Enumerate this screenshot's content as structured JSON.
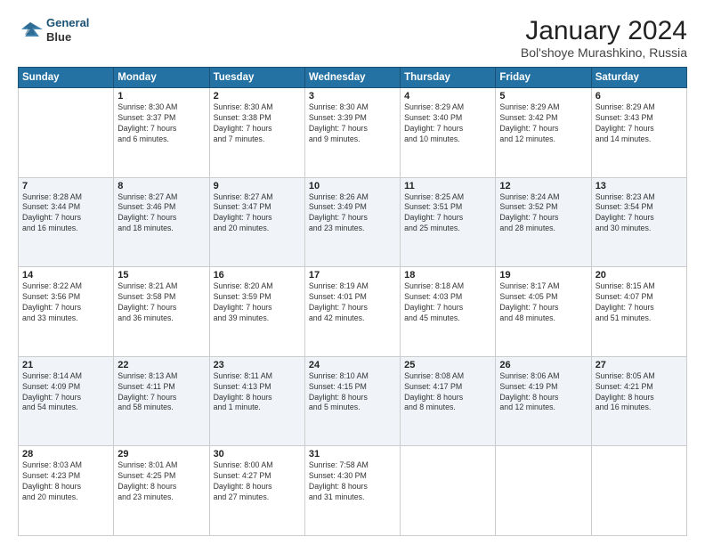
{
  "header": {
    "logo_line1": "General",
    "logo_line2": "Blue",
    "title": "January 2024",
    "subtitle": "Bol'shoye Murashkino, Russia"
  },
  "calendar": {
    "headers": [
      "Sunday",
      "Monday",
      "Tuesday",
      "Wednesday",
      "Thursday",
      "Friday",
      "Saturday"
    ],
    "rows": [
      [
        {
          "day": "",
          "content": ""
        },
        {
          "day": "1",
          "content": "Sunrise: 8:30 AM\nSunset: 3:37 PM\nDaylight: 7 hours\nand 6 minutes."
        },
        {
          "day": "2",
          "content": "Sunrise: 8:30 AM\nSunset: 3:38 PM\nDaylight: 7 hours\nand 7 minutes."
        },
        {
          "day": "3",
          "content": "Sunrise: 8:30 AM\nSunset: 3:39 PM\nDaylight: 7 hours\nand 9 minutes."
        },
        {
          "day": "4",
          "content": "Sunrise: 8:29 AM\nSunset: 3:40 PM\nDaylight: 7 hours\nand 10 minutes."
        },
        {
          "day": "5",
          "content": "Sunrise: 8:29 AM\nSunset: 3:42 PM\nDaylight: 7 hours\nand 12 minutes."
        },
        {
          "day": "6",
          "content": "Sunrise: 8:29 AM\nSunset: 3:43 PM\nDaylight: 7 hours\nand 14 minutes."
        }
      ],
      [
        {
          "day": "7",
          "content": "Sunrise: 8:28 AM\nSunset: 3:44 PM\nDaylight: 7 hours\nand 16 minutes."
        },
        {
          "day": "8",
          "content": "Sunrise: 8:27 AM\nSunset: 3:46 PM\nDaylight: 7 hours\nand 18 minutes."
        },
        {
          "day": "9",
          "content": "Sunrise: 8:27 AM\nSunset: 3:47 PM\nDaylight: 7 hours\nand 20 minutes."
        },
        {
          "day": "10",
          "content": "Sunrise: 8:26 AM\nSunset: 3:49 PM\nDaylight: 7 hours\nand 23 minutes."
        },
        {
          "day": "11",
          "content": "Sunrise: 8:25 AM\nSunset: 3:51 PM\nDaylight: 7 hours\nand 25 minutes."
        },
        {
          "day": "12",
          "content": "Sunrise: 8:24 AM\nSunset: 3:52 PM\nDaylight: 7 hours\nand 28 minutes."
        },
        {
          "day": "13",
          "content": "Sunrise: 8:23 AM\nSunset: 3:54 PM\nDaylight: 7 hours\nand 30 minutes."
        }
      ],
      [
        {
          "day": "14",
          "content": "Sunrise: 8:22 AM\nSunset: 3:56 PM\nDaylight: 7 hours\nand 33 minutes."
        },
        {
          "day": "15",
          "content": "Sunrise: 8:21 AM\nSunset: 3:58 PM\nDaylight: 7 hours\nand 36 minutes."
        },
        {
          "day": "16",
          "content": "Sunrise: 8:20 AM\nSunset: 3:59 PM\nDaylight: 7 hours\nand 39 minutes."
        },
        {
          "day": "17",
          "content": "Sunrise: 8:19 AM\nSunset: 4:01 PM\nDaylight: 7 hours\nand 42 minutes."
        },
        {
          "day": "18",
          "content": "Sunrise: 8:18 AM\nSunset: 4:03 PM\nDaylight: 7 hours\nand 45 minutes."
        },
        {
          "day": "19",
          "content": "Sunrise: 8:17 AM\nSunset: 4:05 PM\nDaylight: 7 hours\nand 48 minutes."
        },
        {
          "day": "20",
          "content": "Sunrise: 8:15 AM\nSunset: 4:07 PM\nDaylight: 7 hours\nand 51 minutes."
        }
      ],
      [
        {
          "day": "21",
          "content": "Sunrise: 8:14 AM\nSunset: 4:09 PM\nDaylight: 7 hours\nand 54 minutes."
        },
        {
          "day": "22",
          "content": "Sunrise: 8:13 AM\nSunset: 4:11 PM\nDaylight: 7 hours\nand 58 minutes."
        },
        {
          "day": "23",
          "content": "Sunrise: 8:11 AM\nSunset: 4:13 PM\nDaylight: 8 hours\nand 1 minute."
        },
        {
          "day": "24",
          "content": "Sunrise: 8:10 AM\nSunset: 4:15 PM\nDaylight: 8 hours\nand 5 minutes."
        },
        {
          "day": "25",
          "content": "Sunrise: 8:08 AM\nSunset: 4:17 PM\nDaylight: 8 hours\nand 8 minutes."
        },
        {
          "day": "26",
          "content": "Sunrise: 8:06 AM\nSunset: 4:19 PM\nDaylight: 8 hours\nand 12 minutes."
        },
        {
          "day": "27",
          "content": "Sunrise: 8:05 AM\nSunset: 4:21 PM\nDaylight: 8 hours\nand 16 minutes."
        }
      ],
      [
        {
          "day": "28",
          "content": "Sunrise: 8:03 AM\nSunset: 4:23 PM\nDaylight: 8 hours\nand 20 minutes."
        },
        {
          "day": "29",
          "content": "Sunrise: 8:01 AM\nSunset: 4:25 PM\nDaylight: 8 hours\nand 23 minutes."
        },
        {
          "day": "30",
          "content": "Sunrise: 8:00 AM\nSunset: 4:27 PM\nDaylight: 8 hours\nand 27 minutes."
        },
        {
          "day": "31",
          "content": "Sunrise: 7:58 AM\nSunset: 4:30 PM\nDaylight: 8 hours\nand 31 minutes."
        },
        {
          "day": "",
          "content": ""
        },
        {
          "day": "",
          "content": ""
        },
        {
          "day": "",
          "content": ""
        }
      ]
    ]
  }
}
